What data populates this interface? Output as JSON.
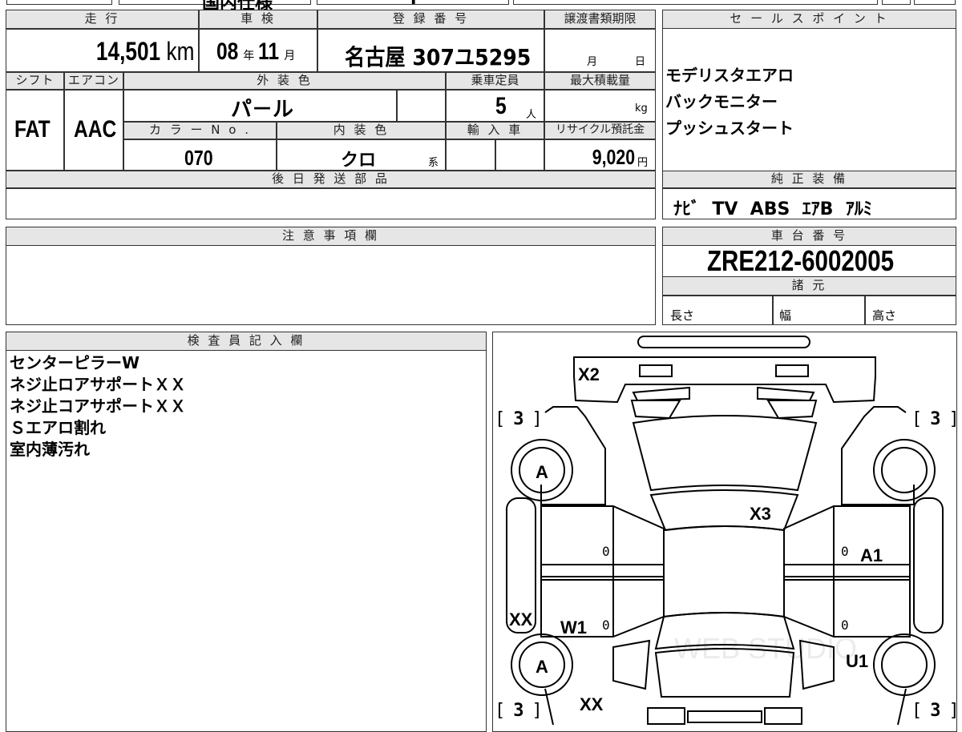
{
  "top_strip": {
    "fragment1": "国内仕様",
    "fragment2": "I"
  },
  "headers": {
    "mileage": "走 行",
    "inspection": "車 検",
    "registration": "登 録 番 号",
    "transfer_deadline": "譲渡書類期限",
    "sales_point": "セ ー ル ス ポ イ ン ト",
    "shift": "シフト",
    "aircon": "エアコン",
    "exterior_color": "外 装 色",
    "capacity": "乗車定員",
    "max_load": "最大積載量",
    "color_no": "カ ラ ー N o .",
    "interior_color": "内 装 色",
    "import": "輸 入 車",
    "recycle_fee": "リサイクル預託金",
    "later_parts": "後 日 発 送 部 品",
    "genuine_equipment": "純 正 装 備",
    "notes": "注 意 事 項 欄",
    "chassis_no": "車 台 番 号",
    "specs": "諸 元",
    "inspector_notes": "検 査 員 記 入 欄"
  },
  "vehicle": {
    "mileage_value": "14,501",
    "mileage_unit": "km",
    "inspection_year": "08",
    "year_unit": "年",
    "inspection_month": "11",
    "month_unit": "月",
    "registration_number": "名古屋 307ユ5295",
    "deadline_month_unit": "月",
    "deadline_day_unit": "日",
    "shift": "FAT",
    "aircon": "AAC",
    "exterior_color": "パ－ル",
    "capacity_value": "5",
    "capacity_unit": "人",
    "max_load_unit": "kg",
    "color_no": "070",
    "interior_color": "クロ",
    "interior_suffix": "系",
    "recycle_fee_value": "9,020",
    "recycle_fee_unit": "円",
    "chassis_no": "ZRE212-6002005",
    "spec_length": "長さ",
    "spec_width": "幅",
    "spec_height": "高さ"
  },
  "sales_points": [
    "モデリスタエアロ",
    "バックモニター",
    "プッシュスタート"
  ],
  "genuine_equipment": "ﾅﾋﾞ  TV  ABS  ｴｱB  ｱﾙﾐ",
  "inspector_notes": [
    "センターピラーW",
    "ネジ止ロアサポートＸＸ",
    "ネジ止コアサポートＸＸ",
    "Ｓエアロ割れ",
    "室内薄汚れ"
  ],
  "diagram": {
    "marks": {
      "front_bumper": "X2",
      "front_left_tire": "A",
      "rear_left_tire": "A",
      "hood_right": "X3",
      "right_front_door": "A1",
      "left_pillar": "XX",
      "left_rear_door": "W1",
      "right_rear_door": "U1",
      "rear_left": "XX"
    },
    "tread": [
      "3",
      "3",
      "3",
      "3"
    ],
    "zero": "0",
    "watermark": "WEB STUDIO"
  }
}
